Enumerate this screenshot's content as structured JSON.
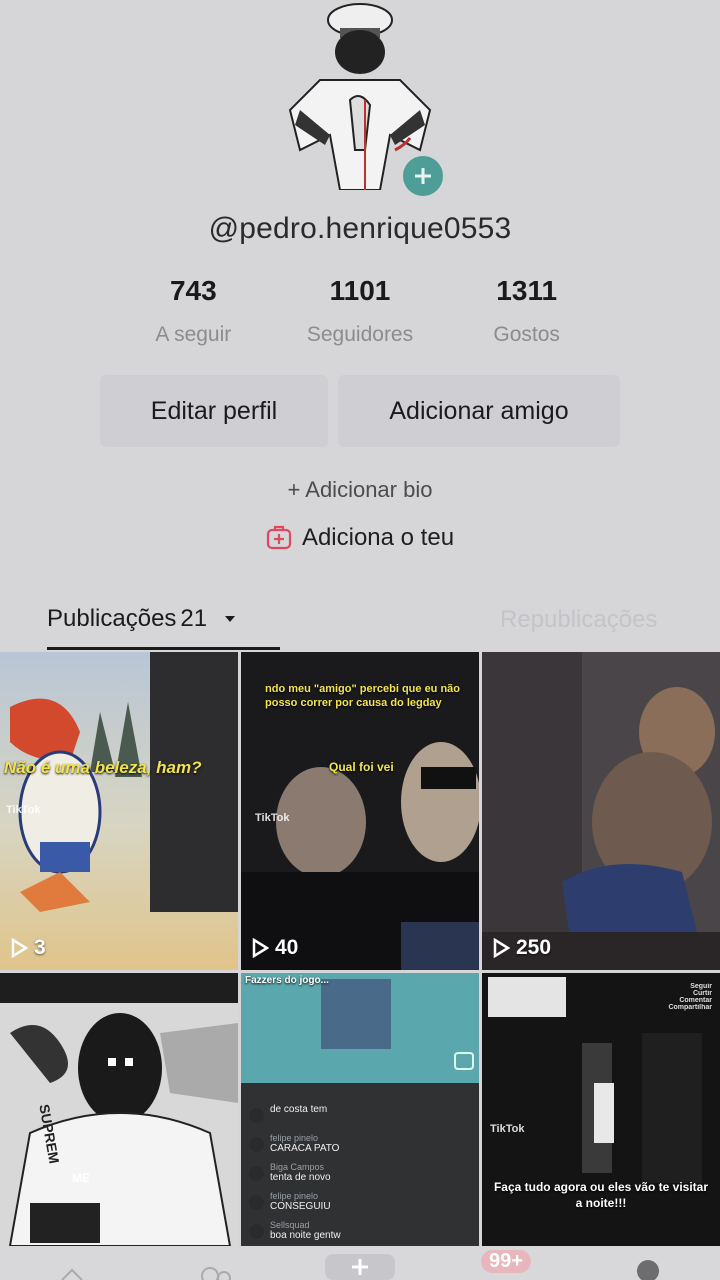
{
  "profile": {
    "username": "@pedro.henrique0553",
    "avatar_icon": "masked-figure-avatar",
    "add_avatar_icon": "plus-icon"
  },
  "stats": [
    {
      "value": "743",
      "label": "A seguir"
    },
    {
      "value": "1101",
      "label": "Seguidores"
    },
    {
      "value": "1311",
      "label": "Gostos"
    }
  ],
  "actions": {
    "edit_label": "Editar perfil",
    "add_friend_label": "Adicionar amigo"
  },
  "bio": {
    "add_bio_label": "+ Adicionar bio",
    "add_link_label": "Adiciona o teu",
    "add_link_icon": "plus-square-icon"
  },
  "tabs": {
    "posts_label": "Publicações",
    "posts_count": "21",
    "reposts_label": "Republicações"
  },
  "videos": [
    {
      "views": "3",
      "caption": "Não é uma beleza, ham?",
      "watermark": "TikTok"
    },
    {
      "views": "40",
      "caption_top": "ndo meu \"amigo\" percebi que eu não posso correr por causa do legday",
      "caption_mid": "Qual foi vei",
      "watermark": "TikTok"
    },
    {
      "views": "250"
    },
    {
      "caption": "SUPREM",
      "subtext": "ME"
    },
    {
      "header": "Fazzers do jogo...",
      "comments": [
        {
          "name": "",
          "text": "de costa tem"
        },
        {
          "name": "felipe pinelo",
          "text": "CARACA PATO"
        },
        {
          "name": "Biga Campos",
          "text": "tenta de novo"
        },
        {
          "name": "felipe pinelo",
          "text": "CONSEGUIU"
        },
        {
          "name": "Sellsquad",
          "text": "boa noite gentw"
        }
      ]
    },
    {
      "caption": "Faça tudo agora ou eles vão te visitar a noite!!!",
      "watermark": "TikTok",
      "side_menu": [
        "Seguir",
        "Curtir",
        "Comentar",
        "Compartilhar"
      ]
    }
  ],
  "bottom_nav": {
    "badge": "99+"
  },
  "colors": {
    "background": "#d6d6d9",
    "accent_teal": "#4e9d97",
    "accent_red": "#e0485f"
  }
}
